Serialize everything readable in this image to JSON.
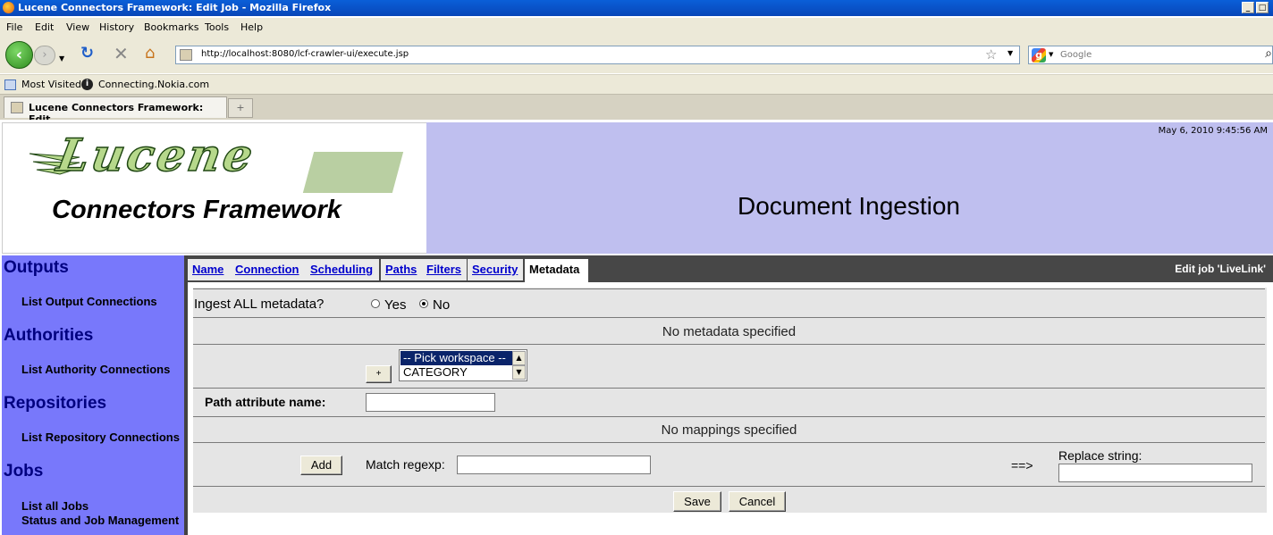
{
  "window": {
    "title": "Lucene Connectors Framework: Edit Job - Mozilla Firefox"
  },
  "menu": [
    "File",
    "Edit",
    "View",
    "History",
    "Bookmarks",
    "Tools",
    "Help"
  ],
  "browser": {
    "url": "http://localhost:8080/lcf-crawler-ui/execute.jsp",
    "search_placeholder": "Google",
    "bookmarks": [
      "Most Visited",
      "Connecting.Nokia.com"
    ],
    "tab_title": "Lucene Connectors Framework: Edit ..."
  },
  "header": {
    "logo_main": "Lucene",
    "logo_sub": "Connectors Framework",
    "date": "May 6, 2010 9:45:56 AM",
    "title": "Document Ingestion"
  },
  "sidebar": {
    "sections": [
      {
        "title": "Outputs",
        "links": [
          "List Output Connections"
        ]
      },
      {
        "title": "Authorities",
        "links": [
          "List Authority Connections"
        ]
      },
      {
        "title": "Repositories",
        "links": [
          "List Repository Connections"
        ]
      },
      {
        "title": "Jobs",
        "links": [
          "List all Jobs",
          "Status and Job Management"
        ]
      }
    ]
  },
  "job_tabs": {
    "tabs": [
      "Name",
      "Connection",
      "Scheduling",
      "Paths",
      "Filters",
      "Security",
      "Metadata"
    ],
    "active": "Metadata",
    "edit_label": "Edit job 'LiveLink'"
  },
  "form": {
    "ingest_all_label": "Ingest ALL metadata?",
    "ingest_options": [
      "Yes",
      "No"
    ],
    "ingest_selected": "No",
    "no_metadata": "No metadata specified",
    "add_metadata_button": "+",
    "workspace_options": [
      "-- Pick workspace --",
      "CATEGORY"
    ],
    "path_attr_label": "Path attribute name:",
    "path_attr_value": "",
    "no_mappings": "No mappings specified",
    "add_button": "Add",
    "match_regexp_label": "Match regexp:",
    "match_regexp_value": "",
    "arrow": "==>",
    "replace_string_label": "Replace string:",
    "replace_string_value": "",
    "save_button": "Save",
    "cancel_button": "Cancel"
  }
}
